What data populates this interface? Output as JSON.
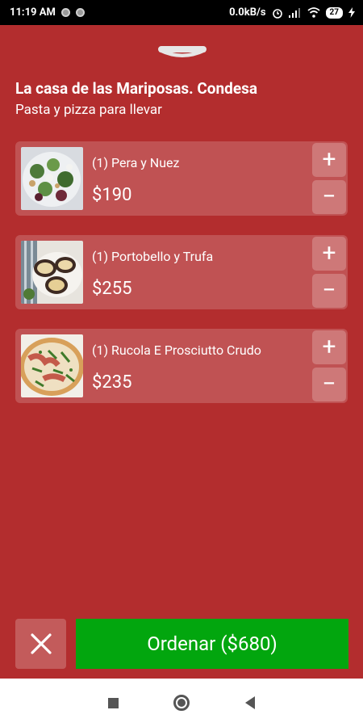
{
  "status_bar": {
    "time": "11:19 AM",
    "network_speed": "0.0kB/s",
    "battery": "27"
  },
  "restaurant": {
    "name": "La casa de las Mariposas. Condesa",
    "subtitle": "Pasta y pizza para llevar"
  },
  "cart": {
    "items": [
      {
        "name": "(1) Pera y Nuez",
        "price": "$190",
        "image": "salad-photo"
      },
      {
        "name": "(1) Portobello y Trufa",
        "price": "$255",
        "image": "portobello-photo"
      },
      {
        "name": "(1) Rucola E Prosciutto Crudo",
        "price": "$235",
        "image": "pizza-photo"
      }
    ],
    "plus_label": "+",
    "minus_label": "−"
  },
  "actions": {
    "order_label": "Ordenar ($680)"
  },
  "colors": {
    "background": "#b32d2e",
    "order_button": "#02a60e"
  }
}
